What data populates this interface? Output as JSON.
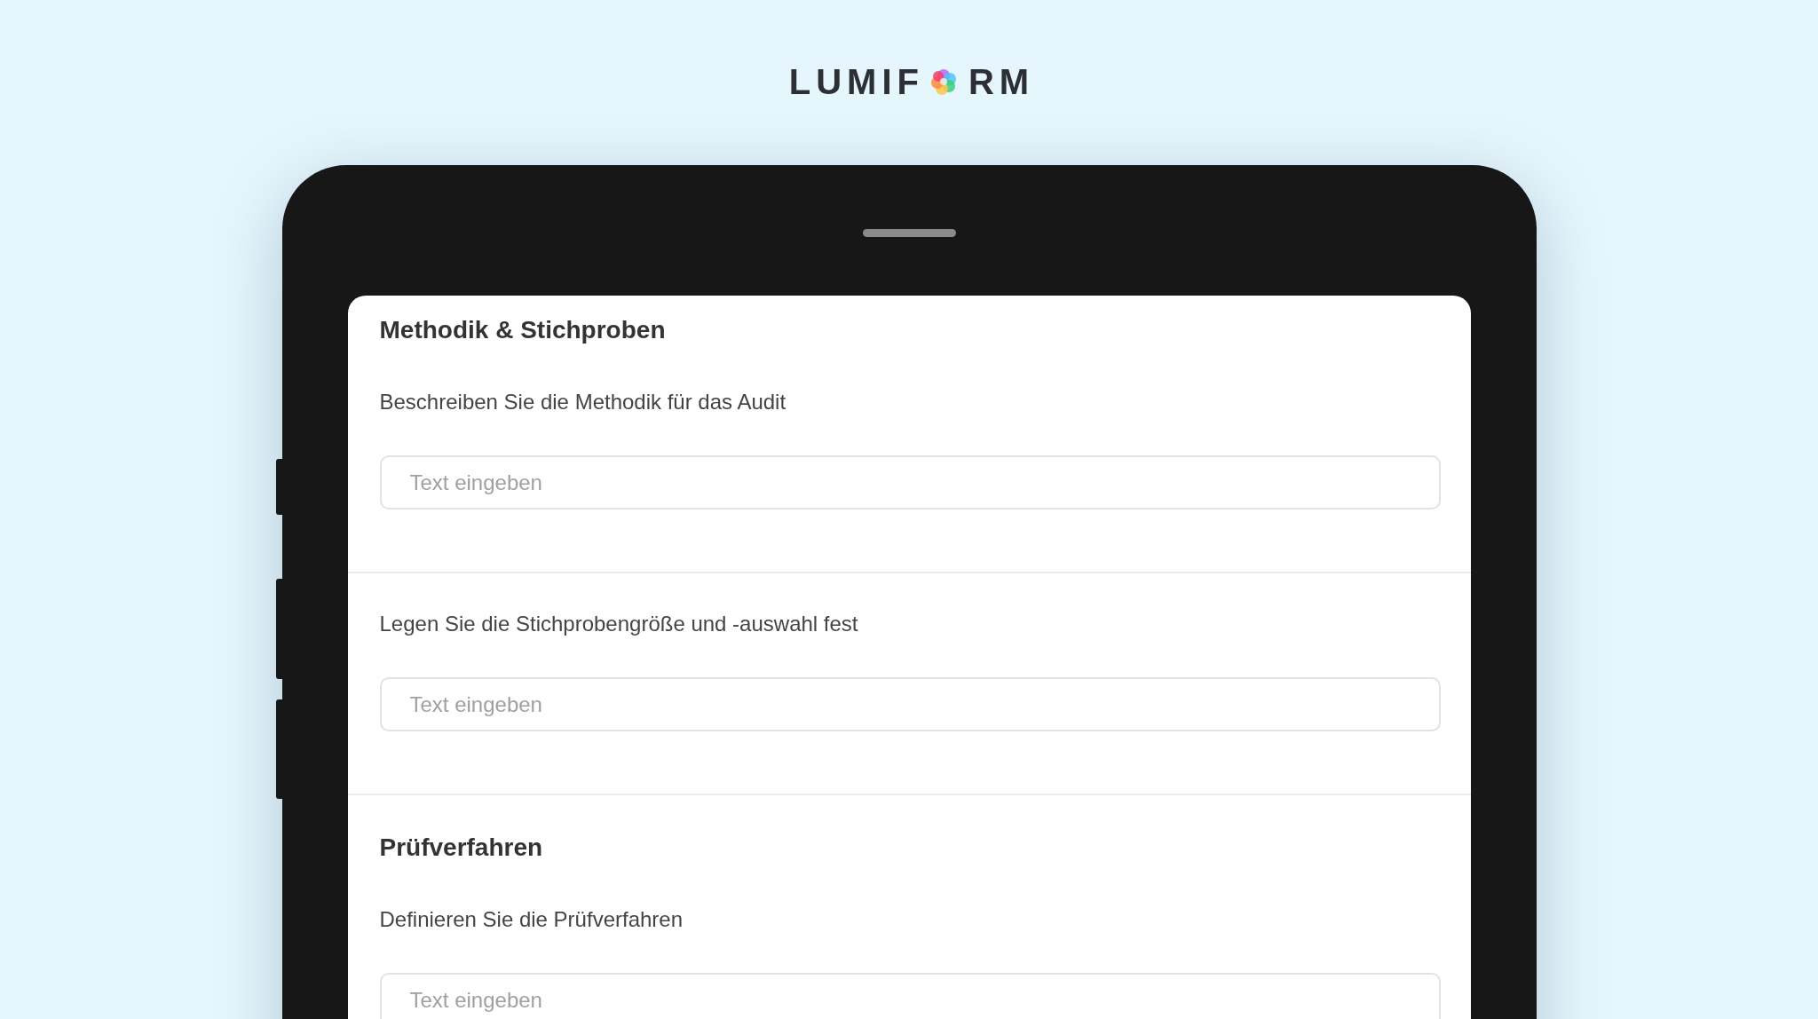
{
  "logo": {
    "text_start": "LUMIF",
    "text_end": "RM"
  },
  "sections": [
    {
      "title": "Methodik & Stichproben",
      "questions": [
        {
          "label": "Beschreiben Sie die Methodik für das Audit",
          "placeholder": "Text eingeben"
        },
        {
          "label": "Legen Sie die Stichprobengröße und -auswahl fest",
          "placeholder": "Text eingeben"
        }
      ]
    },
    {
      "title": "Prüfverfahren",
      "questions": [
        {
          "label": "Definieren Sie die Prüfverfahren",
          "placeholder": "Text eingeben"
        }
      ]
    }
  ]
}
